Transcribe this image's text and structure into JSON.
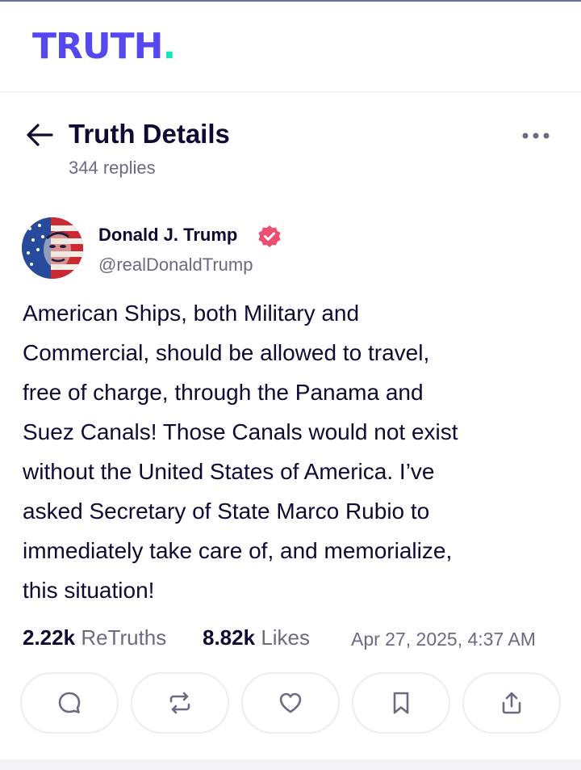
{
  "app": {
    "logo_text": "TRUTH",
    "logo_dot": ".",
    "brand_color": "#5448ee",
    "dot_color": "#17e3b8"
  },
  "header": {
    "title": "Truth Details",
    "subtitle": "344 replies",
    "back_icon": "arrow-left-icon",
    "more_icon": "ellipsis-icon"
  },
  "post": {
    "author": {
      "name": "Donald J. Trump",
      "handle": "@realDonaldTrump",
      "verified_icon": "verified-badge-icon",
      "verified_color": "#ec4f70"
    },
    "body_lines": [
      "American Ships, both Military and",
      "Commercial, should be allowed to travel,",
      "free of charge, through the Panama and",
      "Suez Canals! Those Canals would not exist",
      "without the United States of America. I’ve",
      "asked Secretary of State Marco Rubio to",
      "immediately take care of, and memorialize,",
      "this situation!"
    ],
    "stats": {
      "retruths_count": "2.22k",
      "retruths_label": "ReTruths",
      "likes_count": "8.82k",
      "likes_label": "Likes",
      "timestamp": "Apr 27, 2025, 4:37 AM"
    }
  },
  "actions": [
    {
      "name": "reply-button",
      "icon": "reply-icon"
    },
    {
      "name": "retruth-button",
      "icon": "retruth-icon"
    },
    {
      "name": "like-button",
      "icon": "heart-icon"
    },
    {
      "name": "bookmark-button",
      "icon": "bookmark-icon"
    },
    {
      "name": "share-button",
      "icon": "share-icon"
    }
  ]
}
